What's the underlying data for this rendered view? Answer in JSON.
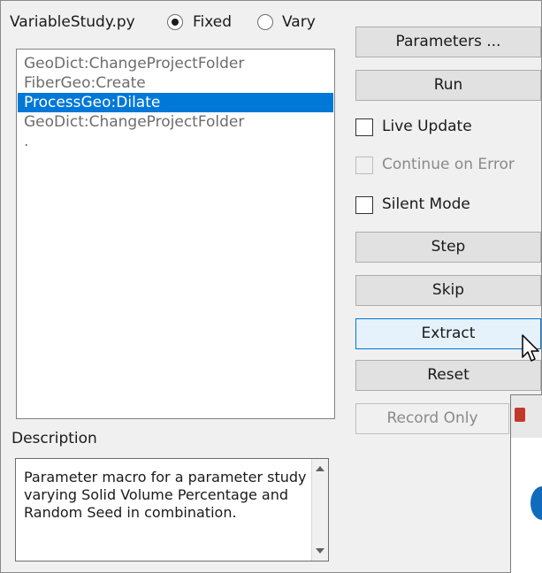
{
  "header": {
    "title": "VariableStudy.py",
    "mode_options": [
      {
        "label": "Fixed",
        "selected": true
      },
      {
        "label": "Vary",
        "selected": false
      }
    ]
  },
  "command_list": {
    "items": [
      {
        "label": "GeoDict:ChangeProjectFolder",
        "selected": false
      },
      {
        "label": "FiberGeo:Create",
        "selected": false
      },
      {
        "label": "ProcessGeo:Dilate",
        "selected": true
      },
      {
        "label": "GeoDict:ChangeProjectFolder",
        "selected": false
      },
      {
        "label": ".",
        "selected": false
      }
    ]
  },
  "description": {
    "label": "Description",
    "text": "Parameter macro for a parameter study varying Solid Volume Percentage and Random Seed in combination."
  },
  "controls": {
    "parameters_button": "Parameters ...",
    "run_button": "Run",
    "live_update": {
      "label": "Live Update",
      "checked": false,
      "enabled": true
    },
    "continue_on_error": {
      "label": "Continue on Error",
      "checked": false,
      "enabled": false
    },
    "silent_mode": {
      "label": "Silent Mode",
      "checked": false,
      "enabled": true
    },
    "step_button": "Step",
    "skip_button": "Skip",
    "extract_button": "Extract",
    "reset_button": "Reset",
    "record_only_button": "Record Only"
  },
  "colors": {
    "selection": "#0078d7",
    "app_logo": "#c0392b",
    "info_icon": "#0f6cbd"
  }
}
